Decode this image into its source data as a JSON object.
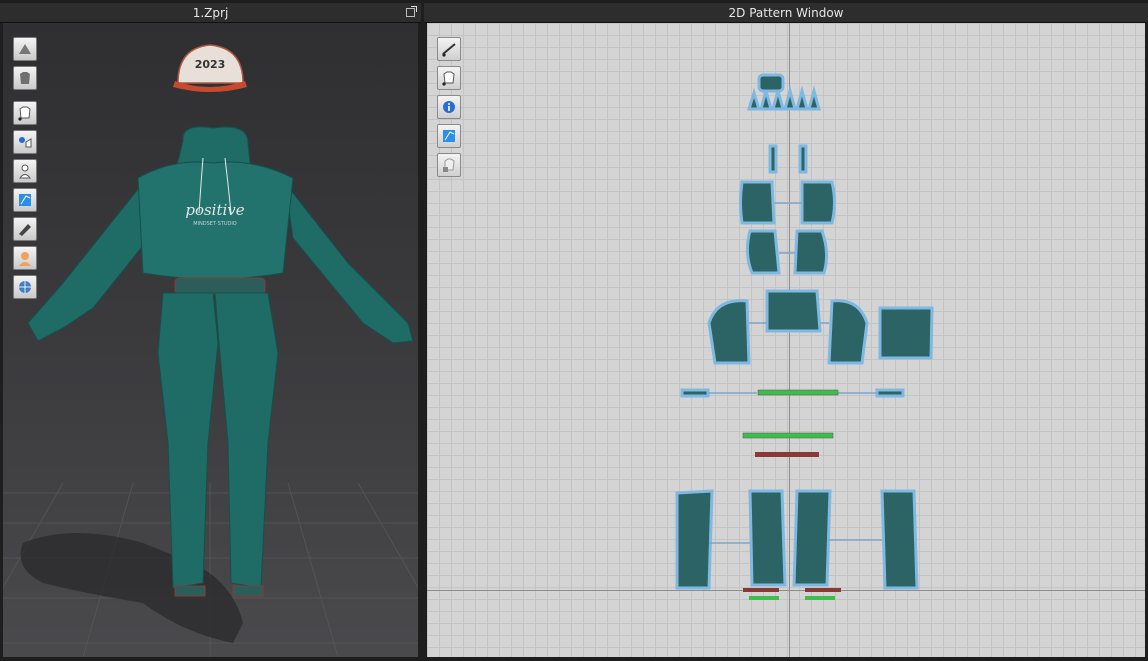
{
  "window3d": {
    "title": "1.Zprj",
    "cap_text": "2023",
    "print_text": "positive",
    "print_subtext": "MINDSET·STUDIO",
    "tools": [
      {
        "name": "render-tool-icon"
      },
      {
        "name": "garment-display-icon"
      },
      {
        "name": "show-garment-icon"
      },
      {
        "name": "show-pins-icon"
      },
      {
        "name": "show-avatar-icon"
      },
      {
        "name": "texture-view-icon"
      },
      {
        "name": "material-view-icon"
      },
      {
        "name": "avatar-skin-icon"
      },
      {
        "name": "environment-icon"
      }
    ]
  },
  "window2d": {
    "title": "2D Pattern Window",
    "tools": [
      {
        "name": "show-baseline-icon"
      },
      {
        "name": "show-garment-icon"
      },
      {
        "name": "pattern-info-icon"
      },
      {
        "name": "texture-2d-icon"
      },
      {
        "name": "lock-garment-icon"
      }
    ]
  },
  "colors": {
    "fabric": "#1f6b66",
    "fabric_dark": "#174f4b",
    "pattern_fill": "#2c6466",
    "pattern_outline": "#7fb8e0",
    "seam_green": "#3bbf4a",
    "seam_red": "#8a3a35"
  }
}
